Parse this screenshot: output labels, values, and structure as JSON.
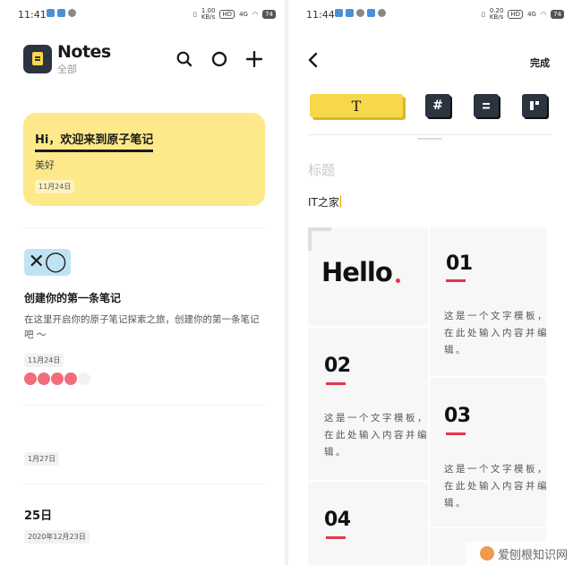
{
  "left": {
    "status": {
      "time": "11:41",
      "net_speed": "1.00",
      "net_unit": "KB/s",
      "hd": "HD",
      "signal": "4G",
      "battery": "74"
    },
    "header": {
      "title": "Notes",
      "subtitle": "全部"
    },
    "icons": {
      "search": "search-icon",
      "circle": "circle-icon",
      "add": "plus-icon"
    },
    "note1": {
      "title": "Hi，欢迎来到原子笔记",
      "body": "美好",
      "date": "11月24日",
      "color": "#fde98a"
    },
    "note2": {
      "glyphs": "✕◯",
      "title": "创建你的第一条笔记",
      "body": "在这里开启你的原子笔记探索之旅，创建你的第一条笔记吧 ～",
      "date": "11月24日",
      "rating": {
        "filled": 4,
        "total": 5,
        "color": "#f26c7a"
      }
    },
    "note3": {
      "date": "1月27日"
    },
    "note4": {
      "title": "25日",
      "date": "2020年12月23日"
    }
  },
  "right": {
    "status": {
      "time": "11:44",
      "net_speed": "0.20",
      "net_unit": "KB/s",
      "hd": "HD",
      "signal": "4G",
      "battery": "74"
    },
    "header": {
      "back_icon": "back-chevron-icon",
      "done": "完成"
    },
    "toolbar": {
      "text_tool": "T",
      "hash_tool": "#",
      "toolbar_accent": "#f7d84a"
    },
    "editor": {
      "title_placeholder": "标题",
      "content": "IT之家"
    },
    "templates": {
      "hello": "Hello",
      "accent": "#e8334a",
      "cards": [
        {
          "num": "01",
          "text": "这是一个文字模板，在此处输入内容并编辑。"
        },
        {
          "num": "02",
          "text": "这是一个文字模板，在此处输入内容并编辑。"
        },
        {
          "num": "03",
          "text": "这是一个文字模板，在此处输入内容并编辑。"
        },
        {
          "num": "04"
        }
      ]
    }
  },
  "watermark": "爱刨根知识网"
}
